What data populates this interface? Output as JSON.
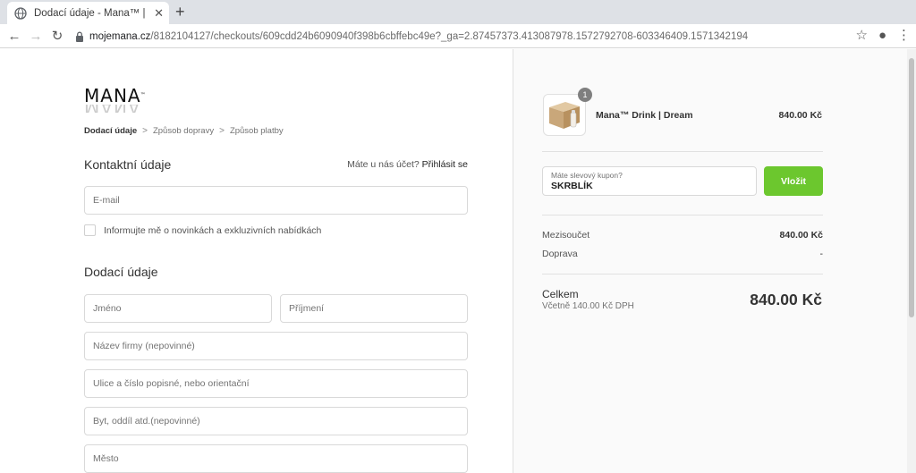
{
  "browser": {
    "tab_title": "Dodací údaje - Mana™ | Česk",
    "url_host": "mojemana.cz",
    "url_path": "/8182104127/checkouts/609cdd24b6090940f398b6cbffebc49e?_ga=2.87457373.413087978.1572792708-603346409.1571342194"
  },
  "logo": {
    "text": "MANA",
    "tm": "™"
  },
  "breadcrumb": {
    "step1": "Dodací údaje",
    "step2": "Způsob dopravy",
    "step3": "Způsob platby"
  },
  "contact": {
    "heading": "Kontaktní údaje",
    "account_question": "Máte u nás účet?",
    "login_link": "Přihlásit se",
    "email_placeholder": "E-mail",
    "newsletter_label": "Informujte mě o novinkách a exkluzivních nabídkách"
  },
  "shipping": {
    "heading": "Dodací údaje",
    "first_name": "Jméno",
    "last_name": "Příjmení",
    "company": "Název firmy (nepovinné)",
    "street": "Ulice a číslo popisné, nebo orientační",
    "apartment": "Byt, oddíl atd.(nepovinné)",
    "city": "Město"
  },
  "summary": {
    "product": {
      "name": "Mana™ Drink | Dream",
      "price": "840.00 Kč",
      "quantity": "1"
    },
    "coupon": {
      "label": "Máte slevový kupon?",
      "value": "SKRBLÍK",
      "button": "Vložit"
    },
    "subtotal_label": "Mezisoučet",
    "subtotal_value": "840.00 Kč",
    "shipping_label": "Doprava",
    "shipping_value": "-",
    "total_label": "Celkem",
    "total_tax": "Včetně 140.00 Kč DPH",
    "total_value": "840.00 Kč"
  },
  "colors": {
    "accent_green": "#6cc72e",
    "badge_gray": "#7f7f7f"
  }
}
